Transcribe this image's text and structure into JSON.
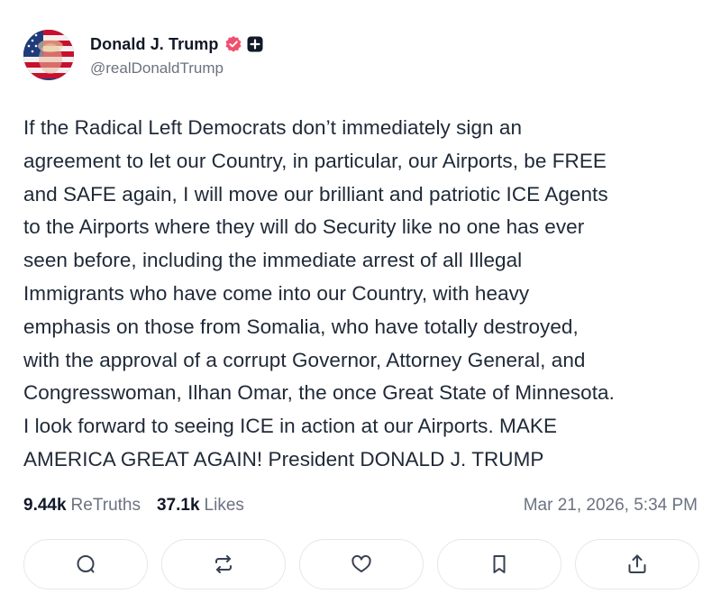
{
  "post": {
    "author": {
      "display_name": "Donald J. Trump",
      "handle": "@realDonaldTrump",
      "verified_icon": "verified-badge-icon",
      "badge_icon": "plus-badge-icon",
      "avatar_icon": "flag-portrait-avatar"
    },
    "text": "If the Radical Left Democrats don’t immediately sign an\nagreement to let our Country, in particular, our Airports, be FREE\nand SAFE again, I will move our brilliant and patriotic ICE Agents\nto the Airports where they will do Security like no one has ever\nseen before, including the immediate arrest of all Illegal\nImmigrants who have come into our Country, with heavy\nemphasis on those from Somalia, who have totally destroyed,\nwith the approval of a corrupt Governor, Attorney General, and\nCongresswoman, Ilhan Omar, the once Great State of Minnesota.\nI look forward to seeing ICE in action at our Airports. MAKE\nAMERICA GREAT AGAIN! President DONALD J. TRUMP",
    "stats": {
      "retruths_count": "9.44k",
      "retruths_label": "ReTruths",
      "likes_count": "37.1k",
      "likes_label": "Likes"
    },
    "timestamp": "Mar 21, 2026, 5:34 PM",
    "actions": [
      "comment-icon",
      "retruth-icon",
      "like-icon",
      "bookmark-icon",
      "share-icon"
    ]
  },
  "colors": {
    "verified_badge": "#f0506e",
    "text_primary": "#111827",
    "text_secondary": "#6b7280",
    "button_border": "#e5e7eb",
    "icon": "#374151"
  }
}
